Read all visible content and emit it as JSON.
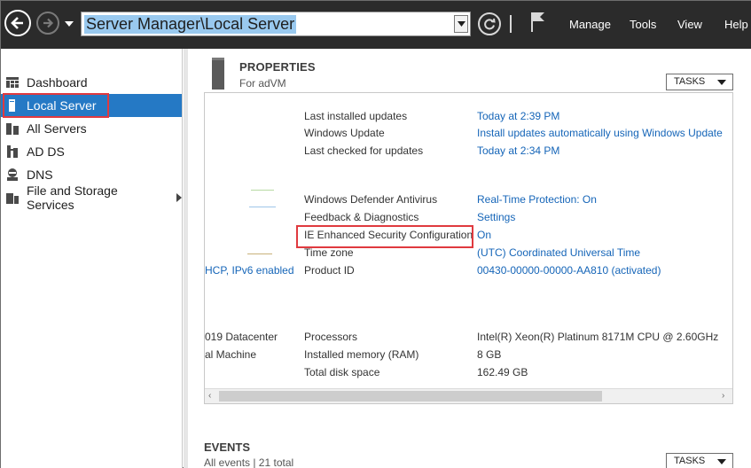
{
  "titlebar": {
    "address": "Server Manager\\Local Server",
    "menu": [
      "Manage",
      "Tools",
      "View",
      "Help"
    ]
  },
  "sidebar": {
    "items": [
      {
        "label": "Dashboard",
        "icon": "dashboard-icon"
      },
      {
        "label": "Local Server",
        "icon": "server-icon"
      },
      {
        "label": "All Servers",
        "icon": "servers-icon"
      },
      {
        "label": "AD DS",
        "icon": "ad-ds-icon"
      },
      {
        "label": "DNS",
        "icon": "dns-icon"
      },
      {
        "label": "File and Storage Services",
        "icon": "storage-icon"
      }
    ]
  },
  "properties": {
    "title": "PROPERTIES",
    "subtitle": "For adVM",
    "tasks_label": "TASKS",
    "left_fragments": [
      "HCP, IPv6 enabled",
      "019 Datacenter",
      "al Machine"
    ],
    "rows": [
      {
        "label": "Last installed updates",
        "value": "Today at 2:39 PM"
      },
      {
        "label": "Windows Update",
        "value": "Install updates automatically using Windows Update"
      },
      {
        "label": "Last checked for updates",
        "value": "Today at 2:34 PM"
      },
      {
        "label": "Windows Defender Antivirus",
        "value": "Real-Time Protection: On"
      },
      {
        "label": "Feedback & Diagnostics",
        "value": "Settings"
      },
      {
        "label": "IE Enhanced Security Configuration",
        "value": "On"
      },
      {
        "label": "Time zone",
        "value": "(UTC) Coordinated Universal Time"
      },
      {
        "label": "Product ID",
        "value": "00430-00000-00000-AA810 (activated)"
      },
      {
        "label": "Processors",
        "value": "Intel(R) Xeon(R) Platinum 8171M CPU @ 2.60GHz"
      },
      {
        "label": "Installed memory (RAM)",
        "value": "8 GB"
      },
      {
        "label": "Total disk space",
        "value": "162.49 GB"
      }
    ]
  },
  "events": {
    "title": "EVENTS",
    "subtitle": "All events | 21 total",
    "tasks_label": "TASKS"
  },
  "colors": {
    "accent": "#2579c5",
    "link": "#1565b8",
    "highlight_border": "#e03a3f",
    "topbar": "#2b2b2b"
  }
}
